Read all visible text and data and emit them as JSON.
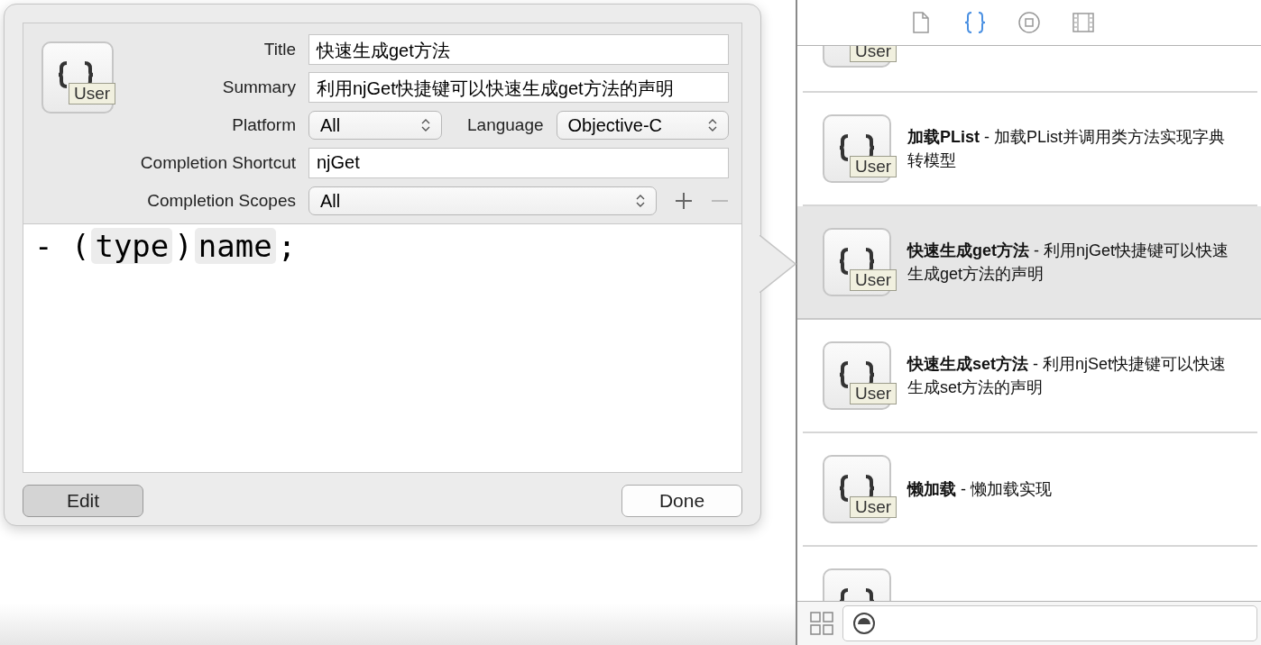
{
  "editor": {
    "icon_badge": "User",
    "title": {
      "label": "Title",
      "value": "快速生成get方法"
    },
    "summary": {
      "label": "Summary",
      "value": "利用njGet快捷键可以快速生成get方法的声明"
    },
    "platform": {
      "label": "Platform",
      "value": "All"
    },
    "language": {
      "label": "Language",
      "value": "Objective-C"
    },
    "completion_shortcut": {
      "label": "Completion Shortcut",
      "value": "njGet"
    },
    "completion_scopes": {
      "label": "Completion Scopes",
      "value": "All"
    },
    "code": [
      {
        "kind": "text",
        "text": "- ("
      },
      {
        "kind": "token",
        "text": "type"
      },
      {
        "kind": "text",
        "text": ")"
      },
      {
        "kind": "token",
        "text": "name"
      },
      {
        "kind": "text",
        "text": ";"
      }
    ],
    "buttons": [
      {
        "label": "Edit",
        "pressed": true
      },
      {
        "label": "Done",
        "pressed": false
      }
    ]
  },
  "library": {
    "tabs": [
      {
        "kind": "file",
        "selected": false
      },
      {
        "kind": "braces",
        "selected": true
      },
      {
        "kind": "circle",
        "selected": false
      },
      {
        "kind": "film",
        "selected": false
      }
    ],
    "items": [
      {
        "kind": "cut_top",
        "badge": "User",
        "selected": false
      },
      {
        "kind": "full",
        "badge": "User",
        "title": "加载PList",
        "separator": "-",
        "summary": "加载PList并调用类方法实现字典转模型",
        "selected": false
      },
      {
        "kind": "full",
        "badge": "User",
        "title": "快速生成get方法",
        "separator": "-",
        "summary": "利用njGet快捷键可以快速生成get方法的声明",
        "selected": true
      },
      {
        "kind": "full",
        "badge": "User",
        "title": "快速生成set方法",
        "separator": "-",
        "summary": "利用njSet快捷键可以快速生成set方法的声明",
        "selected": false
      },
      {
        "kind": "full",
        "badge": "User",
        "title": "懒加载",
        "separator": "-",
        "summary": "懒加载实现",
        "selected": false
      },
      {
        "kind": "cut_bottom",
        "selected": false
      }
    ]
  }
}
